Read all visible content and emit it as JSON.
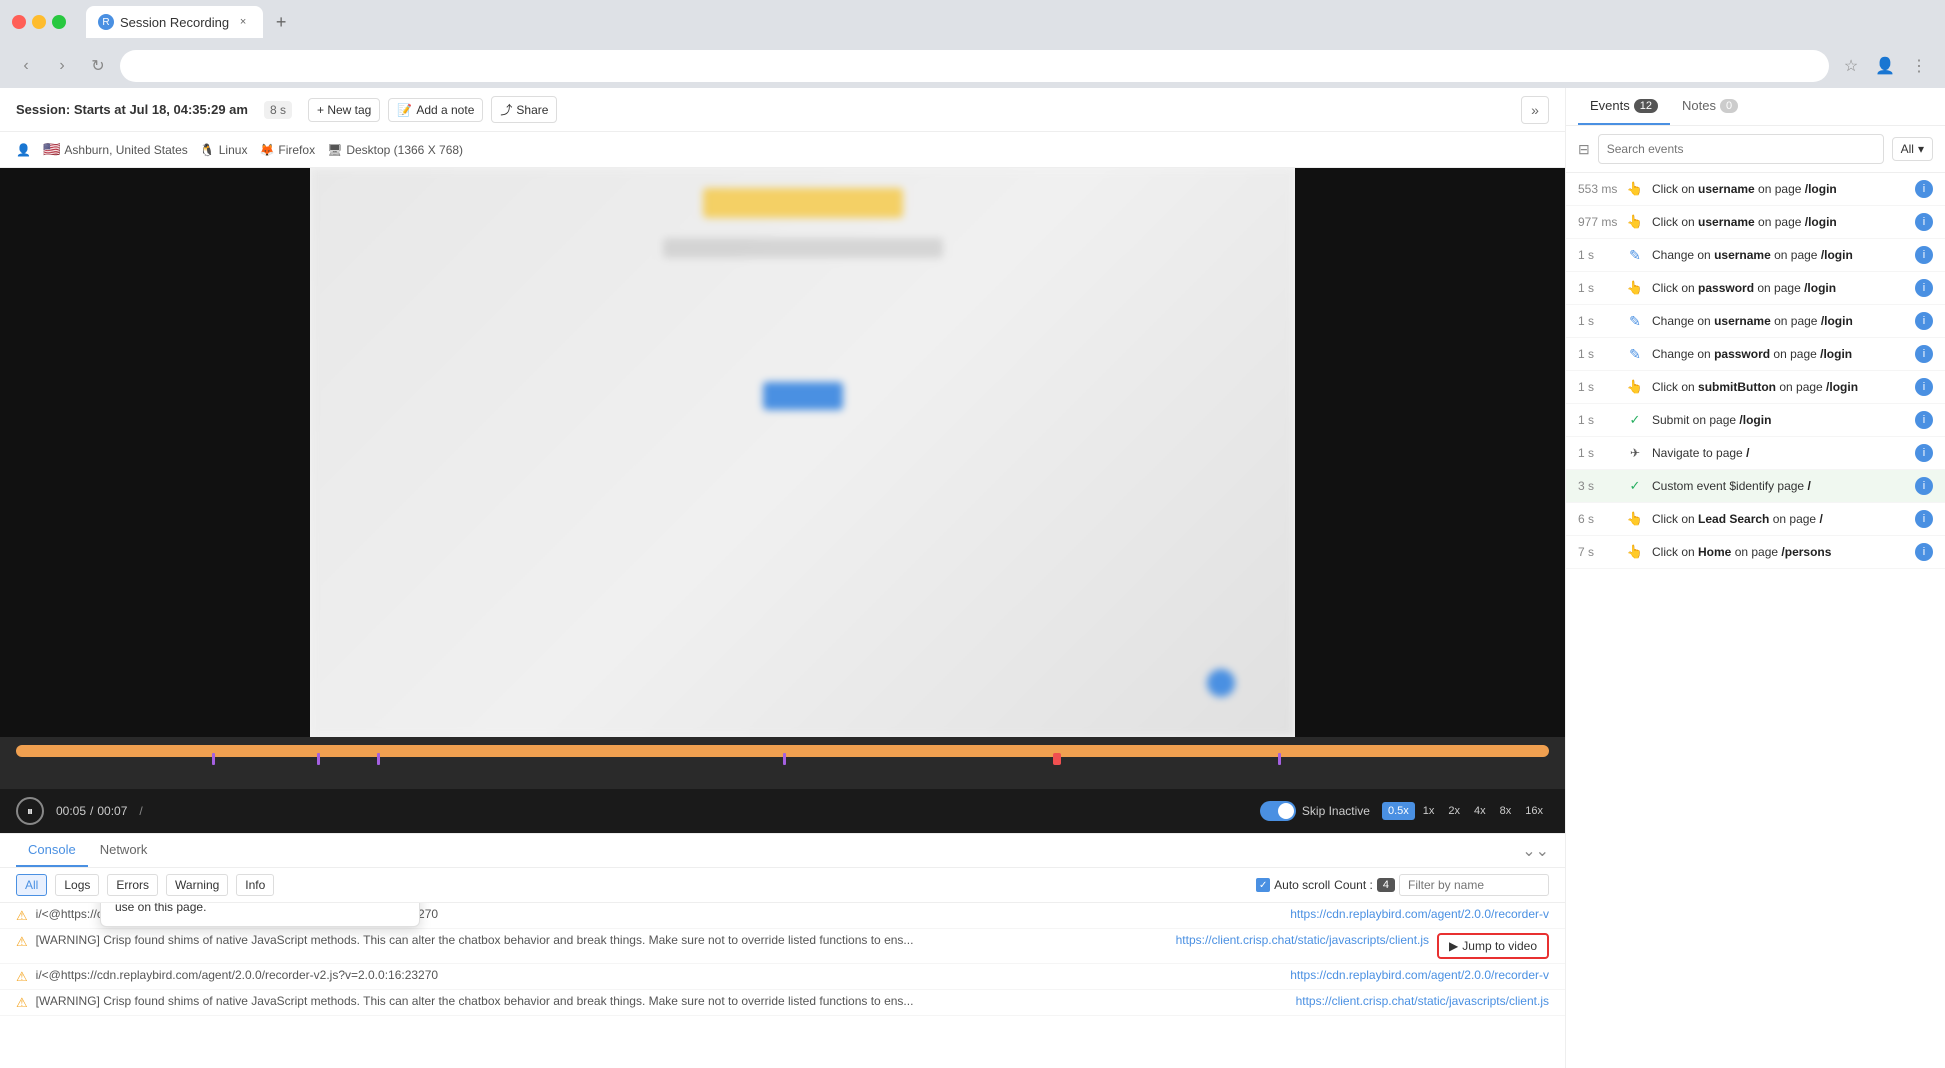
{
  "browser": {
    "tab_title": "Session Recording",
    "tab_close": "×",
    "new_tab": "+",
    "back": "‹",
    "forward": "›",
    "refresh": "↻",
    "bookmark": "☆",
    "profile": "👤",
    "menu": "⋮"
  },
  "session": {
    "title": "Session:",
    "starts_at": "Starts at Jul 18, 04:35:29 am",
    "duration": "8 s",
    "new_tag": "+ New tag",
    "add_note": "Add a note",
    "share": "Share",
    "collapse_icon": "»",
    "location": "Ashburn, United States",
    "os": "Linux",
    "browser": "Firefox",
    "resolution": "Desktop (1366 X 768)"
  },
  "controls": {
    "pause_icon": "⏸",
    "time_current": "00:05",
    "time_total": "00:07",
    "separator": "/",
    "skip_inactive": "Skip Inactive",
    "speeds": [
      "0.5x",
      "1x",
      "2x",
      "4x",
      "8x",
      "16x"
    ],
    "active_speed": "0.5x"
  },
  "bottom_tabs": [
    {
      "id": "console",
      "label": "Console",
      "active": true
    },
    {
      "id": "network",
      "label": "Network",
      "active": false
    }
  ],
  "console": {
    "filters": [
      "All",
      "Logs",
      "Errors",
      "Warning",
      "Info"
    ],
    "active_filter": "All",
    "auto_scroll": "Auto scroll",
    "count_label": "Count :",
    "count_value": "4",
    "filter_placeholder": "Filter by name",
    "rows": [
      {
        "type": "warning",
        "message": "i/<@https://cdn.replaybird.com/agent/2.0.0/recorder-v2.js?v=2.0.0:16:23270",
        "url": "https://cdn.replaybird.com/agent/2.0.0/recorder-v"
      },
      {
        "type": "warning",
        "message": "[WARNING] Crisp found shims of native JavaScript methods. This can alter the chatbox behavior and break things. Make sure not to override listed functions to ens...",
        "url": "https://client.crisp.chat/static/javascripts/client.js",
        "has_jump": true
      },
      {
        "type": "warning",
        "message": "i/<@https://cdn.replaybird.com/agent/2.0.0/recorder-v2.js?v=2.0.0:16:23270",
        "url": "https://cdn.replaybird.com/agent/2.0.0/recorder-v"
      },
      {
        "type": "warning",
        "message": "[WARNING] Crisp found shims of native JavaScript methods. This can alter the chatbox behavior and break things. Make sure not to override listed functions to ens...",
        "url": "https://client.crisp.chat/static/javascripts/client.js"
      }
    ],
    "jump_button": "Jump to video",
    "tooltip": {
      "text": "[WARNING] Crisp found shims of native JavaScript methods. This can alter the chatbox behavior and break things. Make sure not to override listed functions to ensure your chatbox works as expected. You may be looking for other JavaScript libraries in use on this page."
    }
  },
  "events_panel": {
    "tabs": [
      {
        "id": "events",
        "label": "Events",
        "count": "12",
        "active": true
      },
      {
        "id": "notes",
        "label": "Notes",
        "count": "0",
        "active": false
      }
    ],
    "search_placeholder": "Search events",
    "filter_dropdown": "All",
    "events": [
      {
        "time": "553 ms",
        "icon_type": "click",
        "icon": "👆",
        "text_parts": [
          "Click on ",
          "username",
          " on page "
        ],
        "page": "/login",
        "has_info": true
      },
      {
        "time": "977 ms",
        "icon_type": "click",
        "icon": "👆",
        "text_parts": [
          "Click on ",
          "username",
          " on page "
        ],
        "page": "/login",
        "has_info": true
      },
      {
        "time": "1 s",
        "icon_type": "change",
        "icon": "✏️",
        "text_parts": [
          "Change on ",
          "username",
          " on page "
        ],
        "page": "/login",
        "has_info": true
      },
      {
        "time": "1 s",
        "icon_type": "click",
        "icon": "👆",
        "text_parts": [
          "Click on ",
          "password",
          " on page "
        ],
        "page": "/login",
        "has_info": true
      },
      {
        "time": "1 s",
        "icon_type": "change",
        "icon": "✏️",
        "text_parts": [
          "Change on ",
          "username",
          " on page "
        ],
        "page": "/login",
        "has_info": true
      },
      {
        "time": "1 s",
        "icon_type": "change",
        "icon": "✏️",
        "text_parts": [
          "Change on ",
          "password",
          " on page "
        ],
        "page": "/login",
        "has_info": true
      },
      {
        "time": "1 s",
        "icon_type": "click",
        "icon": "👆",
        "text_parts": [
          "Click on ",
          "submitButton",
          " on page "
        ],
        "page": "/login",
        "has_info": true
      },
      {
        "time": "1 s",
        "icon_type": "submit",
        "icon": "✓",
        "text_parts": [
          "Submit on page "
        ],
        "page": "/login",
        "has_info": true
      },
      {
        "time": "1 s",
        "icon_type": "navigate",
        "icon": "➤",
        "text_parts": [
          "Navigate to page "
        ],
        "page": "/",
        "has_info": true
      },
      {
        "time": "3 s",
        "icon_type": "custom",
        "icon": "✓",
        "text_parts": [
          "Custom event $identify page "
        ],
        "page": "/",
        "has_info": true,
        "active": true
      },
      {
        "time": "6 s",
        "icon_type": "click",
        "icon": "👆",
        "text_parts": [
          "Click on ",
          "Lead Search",
          " on page "
        ],
        "page": "/",
        "has_info": true
      },
      {
        "time": "7 s",
        "icon_type": "click",
        "icon": "👆",
        "text_parts": [
          "Click on ",
          "Home",
          " on page "
        ],
        "page": "/persons",
        "has_info": true
      }
    ]
  }
}
